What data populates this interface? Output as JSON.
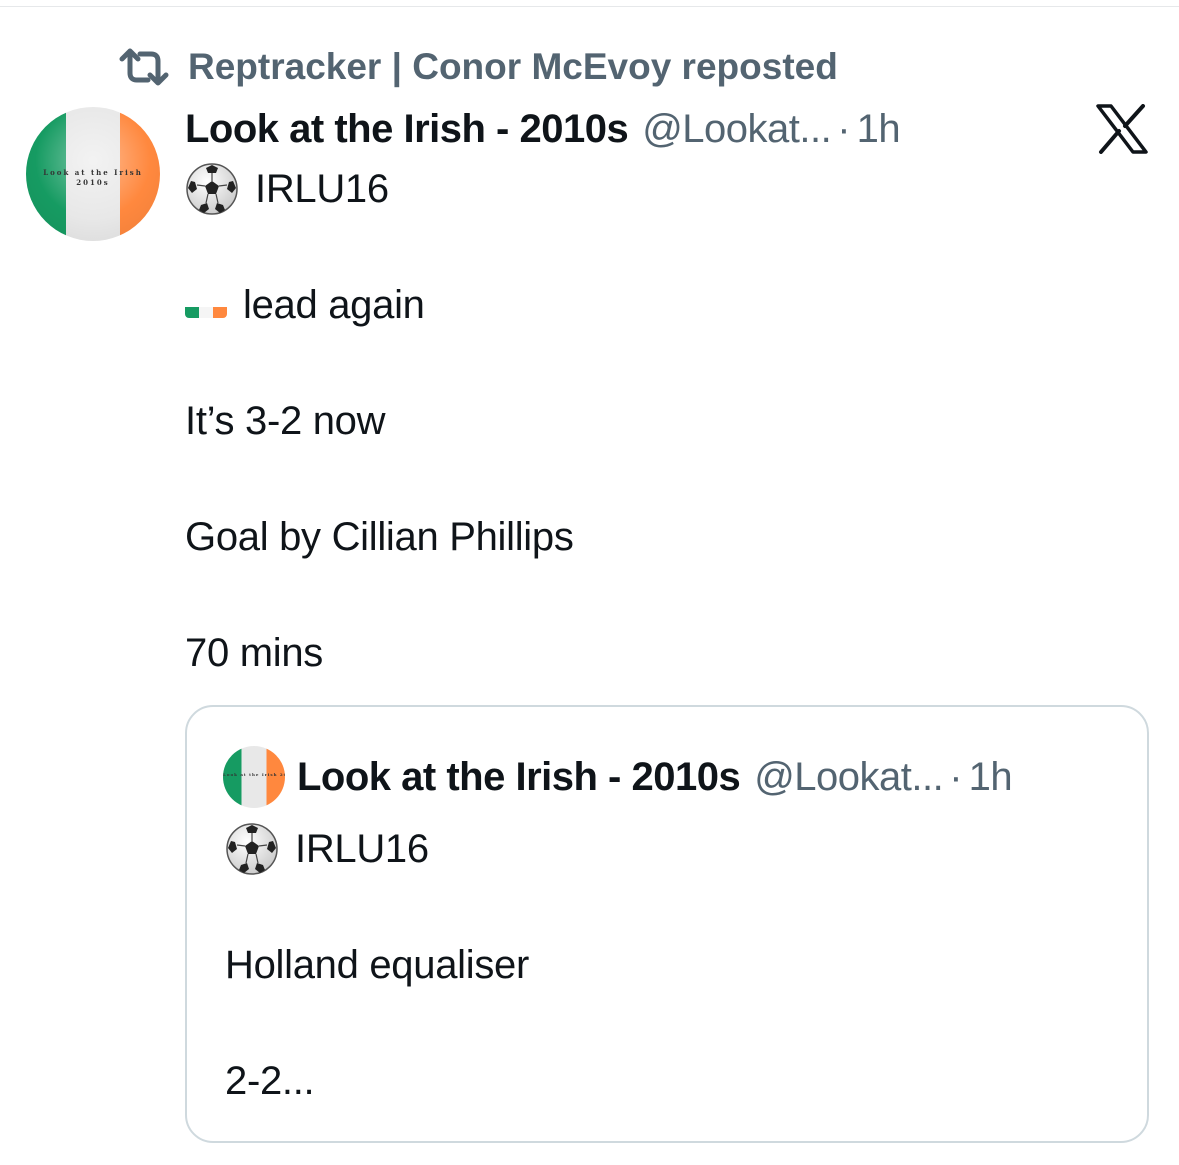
{
  "repost": {
    "icon": "repost-icon",
    "text": "Reptracker | Conor McEvoy reposted"
  },
  "tweet": {
    "avatar_text_line1": "Look at the Irish",
    "avatar_text_line2": "2010s",
    "display_name": "Look at the Irish - 2010s",
    "handle": "@Lookat...",
    "separator": "·",
    "time": "1h",
    "platform_icon": "x-logo-icon",
    "lines": {
      "l1": "IRLU16",
      "l2": "lead again",
      "l3": "It’s 3-2 now",
      "l4": "Goal by Cillian Phillips",
      "l5": "70 mins"
    }
  },
  "quoted_tweet": {
    "avatar_text": "Look at the Irish 2010s",
    "display_name": "Look at the Irish - 2010s",
    "handle": "@Lookat...",
    "separator": "·",
    "time": "1h",
    "lines": {
      "l1": "IRLU16",
      "l2": "Holland equaliser",
      "l3": "2-2..."
    }
  },
  "colors": {
    "text_primary": "#0f1419",
    "text_secondary": "#536471",
    "border": "#cfd9de",
    "irish_green": "#169b62",
    "irish_white": "#e8e8e8",
    "irish_orange": "#ff883e"
  }
}
